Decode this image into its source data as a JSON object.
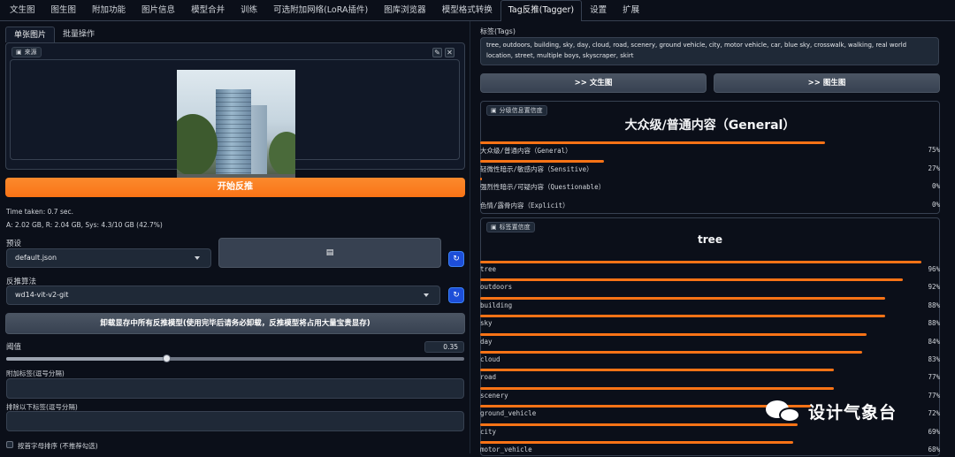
{
  "tabs": [
    "文生图",
    "图生图",
    "附加功能",
    "图片信息",
    "模型合并",
    "训练",
    "可选附加网络(LoRA插件)",
    "图库浏览器",
    "模型格式转换",
    "Tag反推(Tagger)",
    "设置",
    "扩展"
  ],
  "active_tab_index": 9,
  "left": {
    "subtabs": [
      "单张图片",
      "批量操作"
    ],
    "source_label": "来源",
    "edit_icon": "pencil-icon",
    "close_icon": "close-icon",
    "interrogate_button": "开始反推",
    "time_taken": "Time taken: 0.7 sec.",
    "vram": "A: 2.02 GB, R: 2.04 GB, Sys: 4.3/10 GB (42.7%)",
    "preset_label": "预设",
    "preset_value": "default.json",
    "interrogator_label": "反推算法",
    "interrogator_value": "wd14-vit-v2-git",
    "unload_button": "卸载显存中所有反推模型(使用完毕后请务必卸载，反推模型将占用大量宝贵显存)",
    "threshold_label": "阈值",
    "threshold_value": "0.35",
    "threshold": 0.35,
    "additional_tags_label": "附加标签(逗号分隔)",
    "exclude_tags_label": "排除以下标签(逗号分隔)",
    "sort_label": "按首字母排序 (不推荐勾选)"
  },
  "right": {
    "tags_label": "标签(Tags)",
    "tags_text": "tree, outdoors, building, sky, day, cloud, road, scenery, ground vehicle, city, motor vehicle, car, blue sky, crosswalk, walking, real world location, street, multiple boys, skyscraper, skirt",
    "send_txt2img": ">> 文生图",
    "send_img2img": ">> 图生图",
    "rating_chip": "分级信息置信度",
    "rating_title": "大众级/普通内容（General）",
    "ratings": [
      {
        "name": "大众级/普通内容（General）",
        "pct": "75%",
        "value": 0.75
      },
      {
        "name": "轻微性暗示/敏感内容（Sensitive）",
        "pct": "27%",
        "value": 0.27
      },
      {
        "name": "强烈性暗示/可疑内容（Questionable）",
        "pct": "0%",
        "value": 0.003
      },
      {
        "name": "色情/露骨内容（Explicit）",
        "pct": "0%",
        "value": 0.0
      }
    ],
    "tags_chip": "标签置信度",
    "tags_title": "tree",
    "tag_confidences": [
      {
        "name": "tree",
        "pct": "96%",
        "value": 0.96
      },
      {
        "name": "outdoors",
        "pct": "92%",
        "value": 0.92
      },
      {
        "name": "building",
        "pct": "88%",
        "value": 0.88
      },
      {
        "name": "sky",
        "pct": "88%",
        "value": 0.88
      },
      {
        "name": "day",
        "pct": "84%",
        "value": 0.84
      },
      {
        "name": "cloud",
        "pct": "83%",
        "value": 0.83
      },
      {
        "name": "road",
        "pct": "77%",
        "value": 0.77
      },
      {
        "name": "scenery",
        "pct": "77%",
        "value": 0.77
      },
      {
        "name": "ground_vehicle",
        "pct": "72%",
        "value": 0.72
      },
      {
        "name": "city",
        "pct": "69%",
        "value": 0.69
      },
      {
        "name": "motor_vehicle",
        "pct": "68%",
        "value": 0.68
      }
    ]
  },
  "watermark": "设计气象台",
  "colors": {
    "accent": "#f97316",
    "background": "#0b0f19",
    "panel": "#111827",
    "border": "#374151",
    "blue": "#1d4ed8"
  }
}
